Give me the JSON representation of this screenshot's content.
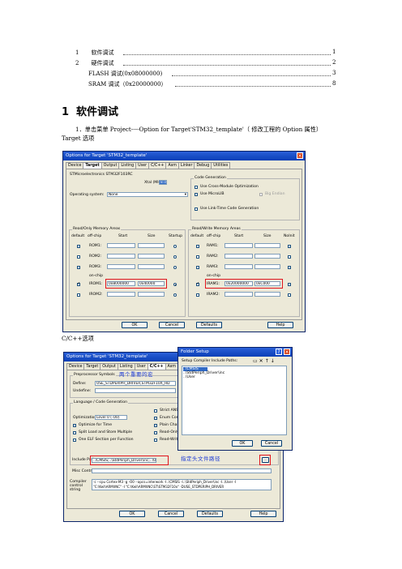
{
  "toc": [
    {
      "num": "1",
      "title": "软件调试",
      "page": "1"
    },
    {
      "num": "2",
      "title": "硬件调试",
      "page": "2"
    },
    {
      "num": "",
      "title": "FLASH 调试(0x08000000)",
      "page": "3"
    },
    {
      "num": "",
      "title": "SRAM 调试（0x20000000）",
      "page": "8"
    }
  ],
  "heading": {
    "num": "1",
    "title": "软件调试"
  },
  "para1": "1．单击菜单 Project----Option for Target'STM32_template'（ 修改工程的 Option 属性）",
  "para1b": "Target 选项",
  "caption2": "C/C++选项",
  "dialog1": {
    "title": "Options for Target 'STM32_template'",
    "tabs": [
      "Device",
      "Target",
      "Output",
      "Listing",
      "User",
      "C/C++",
      "Asm",
      "Linker",
      "Debug",
      "Utilities"
    ],
    "active_tab": "Target",
    "device": "STMicroelectronics STM32F103RC",
    "xtal_label": "Xtal (MHz):",
    "xtal_value": "8.0",
    "os_label": "Operating system:",
    "os_value": "None",
    "codegen_title": "Code Generation",
    "codegen_opts": [
      "Use Cross-Module Optimization",
      "Use MicroLIB",
      "Big Endian",
      "Use Link-Time Code Generation"
    ],
    "ro_title": "Read/Only Memory Areas",
    "rw_title": "Read/Write Memory Areas",
    "col_default": "default",
    "col_offchip": "off-chip",
    "col_start": "Start",
    "col_size": "Size",
    "col_startup": "Startup",
    "col_noinit": "NoInit",
    "onchip": "on-chip",
    "rom_rows": [
      "ROM1:",
      "ROM2:",
      "ROM3:"
    ],
    "irom_rows": [
      "IROM1:",
      "IROM2:"
    ],
    "irom1_start": "0x8000000",
    "irom1_size": "0x40000",
    "ram_rows": [
      "RAM1:",
      "RAM2:",
      "RAM3:"
    ],
    "iram_rows": [
      "IRAM1:",
      "IRAM2:"
    ],
    "iram1_start": "0x20000000",
    "iram1_size": "0xC000",
    "buttons": [
      "OK",
      "Cancel",
      "Defaults",
      "Help"
    ]
  },
  "dialog2": {
    "title": "Options for Target 'STM32_template'",
    "tabs": [
      "Device",
      "Target",
      "Output",
      "Listing",
      "User",
      "C/C++",
      "Asm"
    ],
    "active_tab": "C/C++",
    "preproc_title": "Preprocessor Symbols",
    "define_label": "Define:",
    "define_value": "USE_STDPERIPH_DRIVER,STM32F10X_HD",
    "undefine_label": "Undefine:",
    "annot_macros": "两个重要的宏",
    "lang_title": "Language / Code Generation",
    "optim_label": "Optimization:",
    "optim_value": "Level 0 (-O0)",
    "left_opts": [
      "Optimize for Time",
      "Split Load and Store Multiple",
      "One ELF Section per Function"
    ],
    "right_opts": [
      "Strict ANSI C",
      "Enum Container",
      "Plain Char is S",
      "Read-Only Po",
      "Read-Write Po"
    ],
    "include_label": "Include Paths",
    "include_value": "..\\CMSIS;..\\StdPeriph_Driver\\inc;..\\User",
    "annot_include": "指定头文件路径",
    "misc_label": "Misc Controls",
    "compiler_label": "Compiler control string",
    "compiler_line1": "-c --cpu Cortex-M3 -g -O0 --apcs=interwork -I..\\CMSIS -I..\\StdPeriph_Driver\\inc -I..\\User -I",
    "compiler_line2": "\"C:\\Keil\\ARM\\INC\" -I \"C:\\Keil\\ARM\\INC\\ST\\STM32F10x\" -DUSE_STDPERIPH_DRIVER",
    "buttons": [
      "OK",
      "Cancel",
      "Defaults",
      "Help"
    ]
  },
  "folder": {
    "title": "Folder Setup",
    "label": "Setup Compiler Include Paths:",
    "items": [
      "..\\CMSIS",
      "..\\StdPeriph_Driver\\inc",
      "..\\User"
    ],
    "buttons": [
      "OK",
      "Cancel"
    ]
  }
}
